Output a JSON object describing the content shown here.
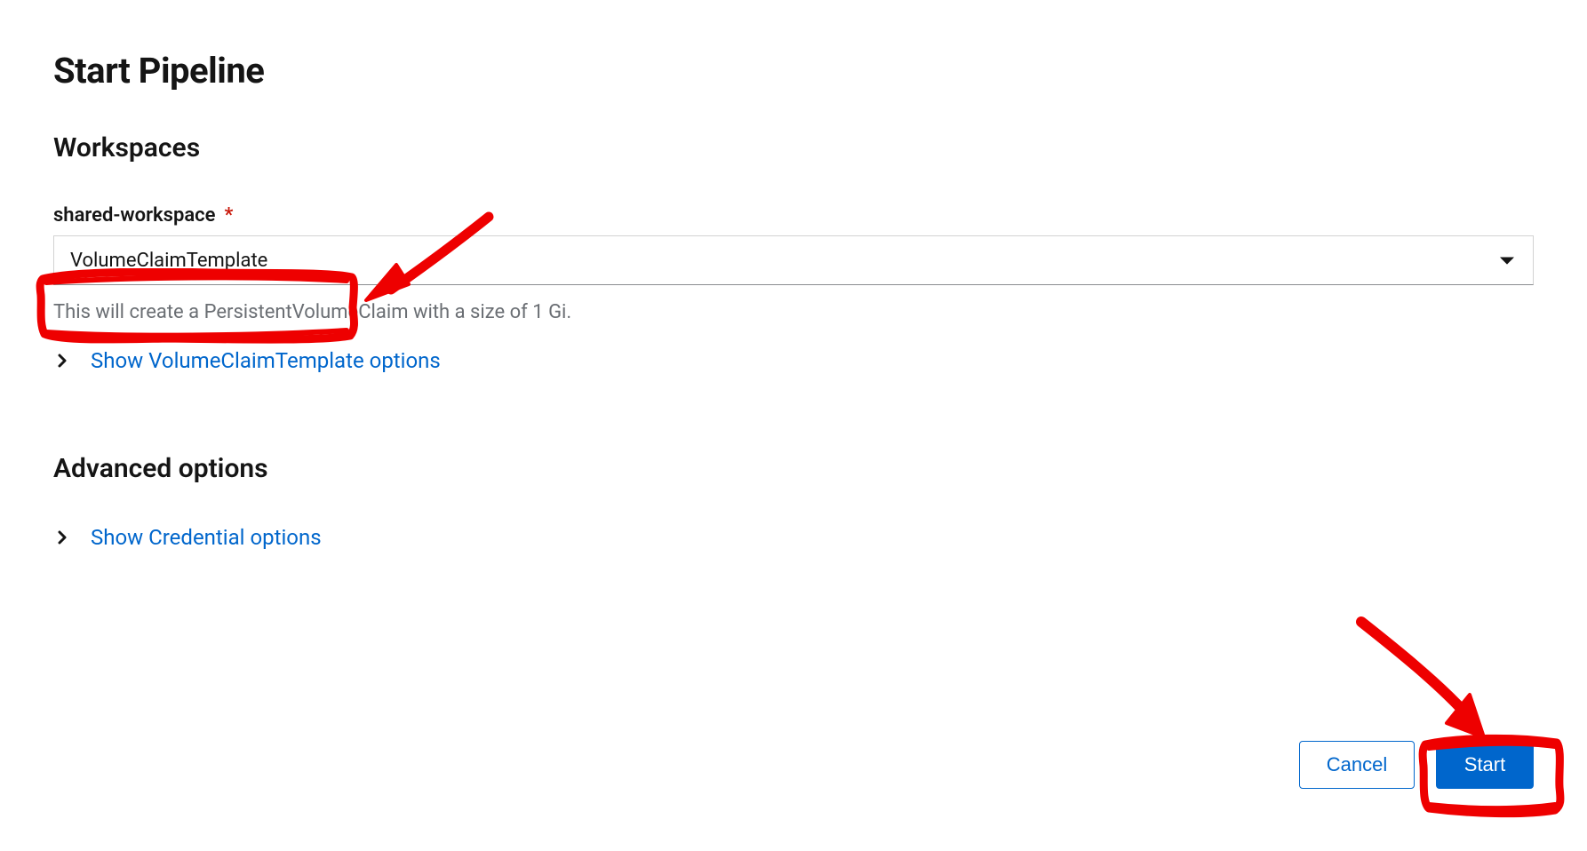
{
  "title": "Start Pipeline",
  "sections": {
    "workspaces": {
      "heading": "Workspaces",
      "field": {
        "label": "shared-workspace",
        "required_marker": "*",
        "selected": "VolumeClaimTemplate",
        "help": "This will create a PersistentVolumeClaim with a size of 1 Gi.",
        "expander_label": "Show VolumeClaimTemplate options"
      }
    },
    "advanced": {
      "heading": "Advanced options",
      "expander_label": "Show Credential options"
    }
  },
  "footer": {
    "cancel": "Cancel",
    "start": "Start"
  }
}
